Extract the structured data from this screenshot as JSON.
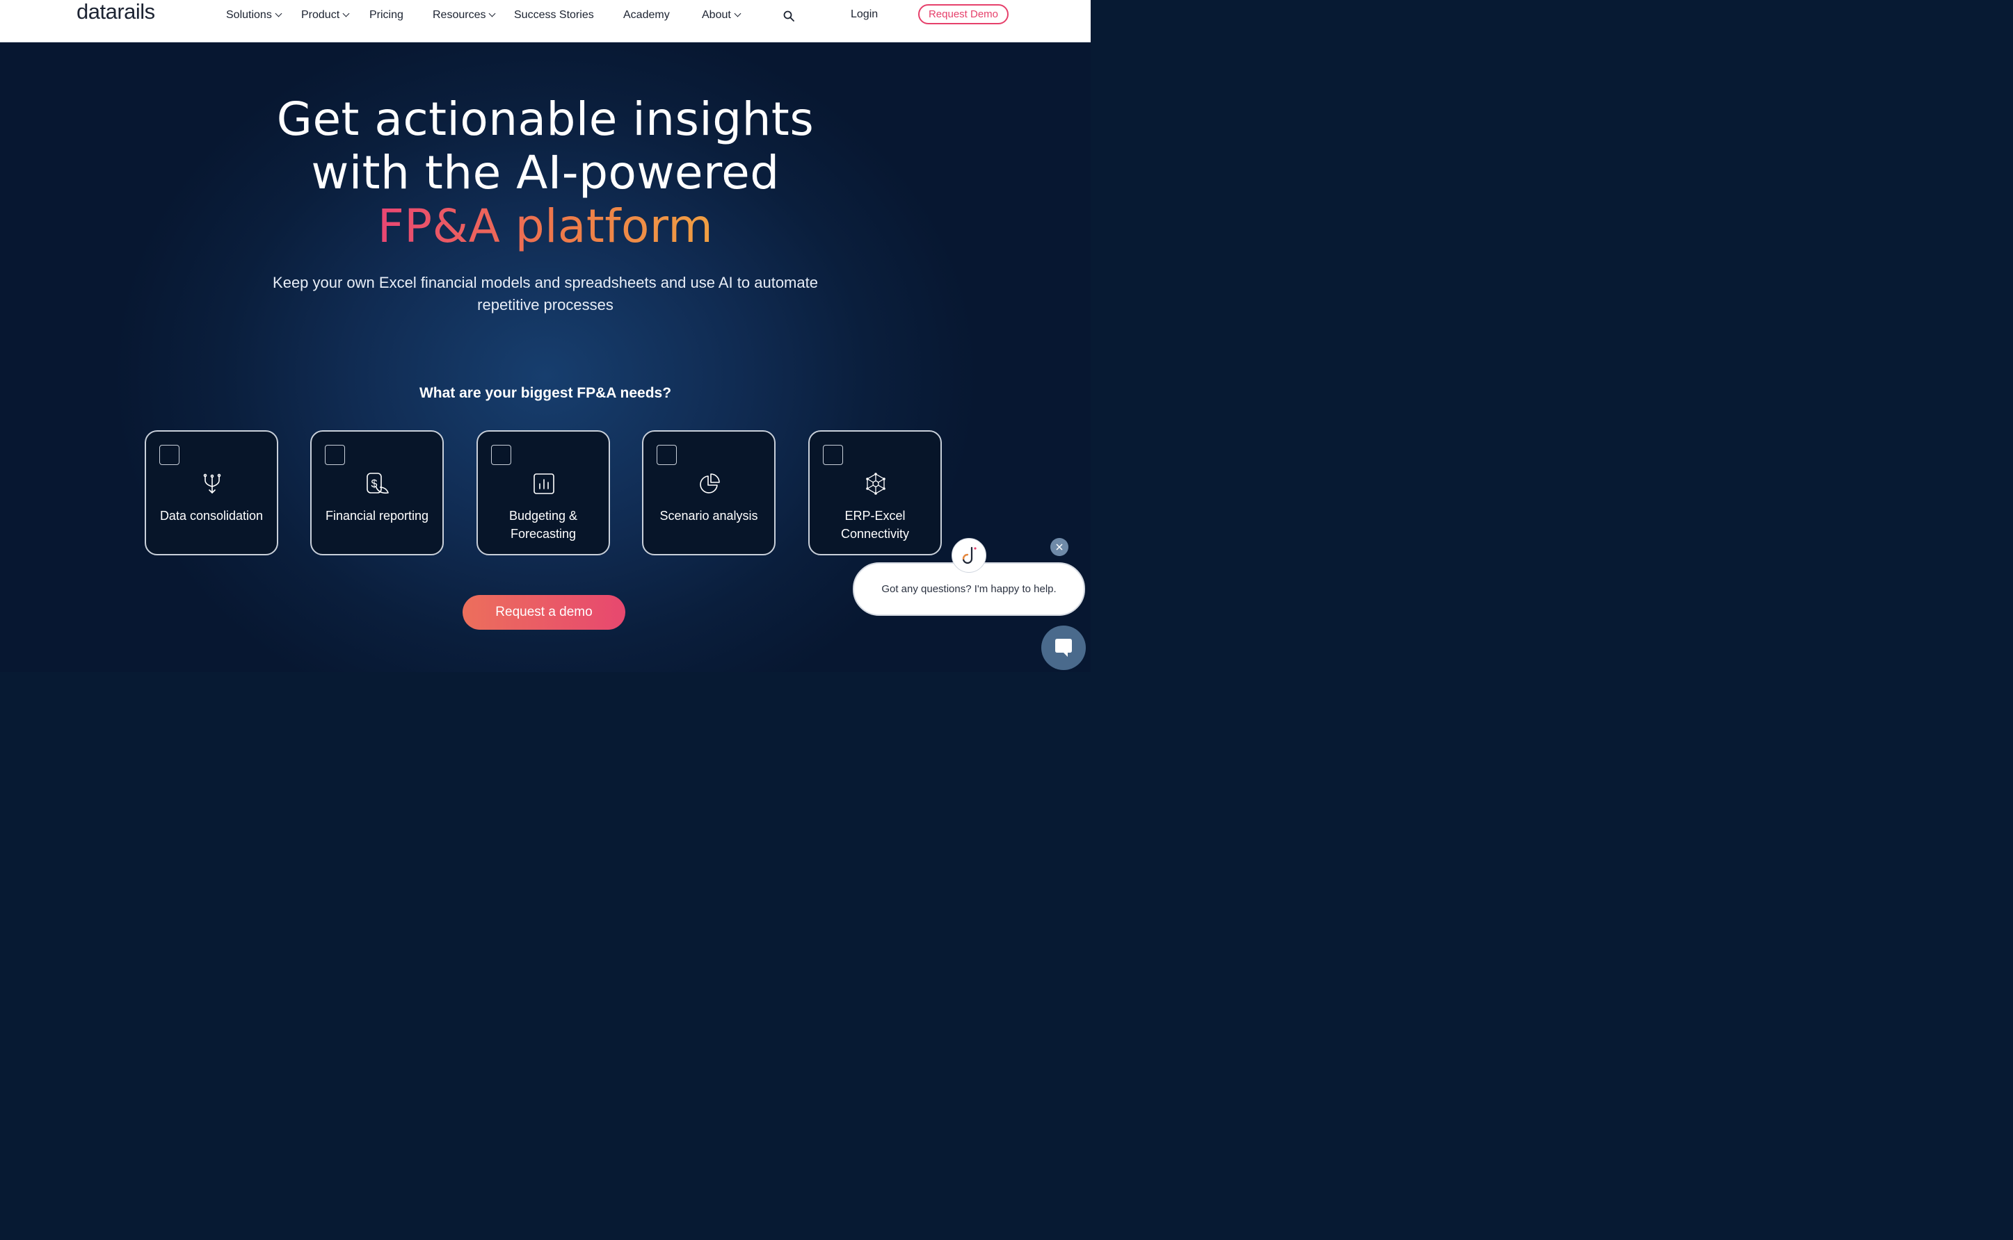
{
  "nav": {
    "logo": "datarails",
    "items": [
      {
        "label": "Solutions",
        "dropdown": true
      },
      {
        "label": "Product",
        "dropdown": true
      },
      {
        "label": "Pricing",
        "dropdown": false
      },
      {
        "label": "Resources",
        "dropdown": true
      },
      {
        "label": "Success Stories",
        "dropdown": false
      },
      {
        "label": "Academy",
        "dropdown": false
      },
      {
        "label": "About",
        "dropdown": true
      }
    ],
    "login": "Login",
    "request_demo": "Request Demo"
  },
  "hero": {
    "headline_line1": "Get actionable insights",
    "headline_line2": "with the AI-powered",
    "headline_highlight": "FP&A platform",
    "subtitle": "Keep your own Excel financial models and spreadsheets and use AI to automate repetitive processes",
    "question": "What are your biggest FP&A needs?",
    "cards": [
      {
        "label": "Data consolidation",
        "icon": "merge-arrows-icon"
      },
      {
        "label": "Financial reporting",
        "icon": "dollar-report-icon"
      },
      {
        "label": "Budgeting & Forecasting",
        "icon": "bar-chart-icon"
      },
      {
        "label": "Scenario analysis",
        "icon": "pie-chart-icon"
      },
      {
        "label": "ERP-Excel Connectivity",
        "icon": "network-icon"
      }
    ],
    "cta": "Request a demo"
  },
  "chat": {
    "message": "Got any questions? I'm happy to help."
  },
  "colors": {
    "accent_pink": "#e6406b",
    "accent_orange": "#f0a043",
    "hero_bg": "#0a1e3c"
  }
}
